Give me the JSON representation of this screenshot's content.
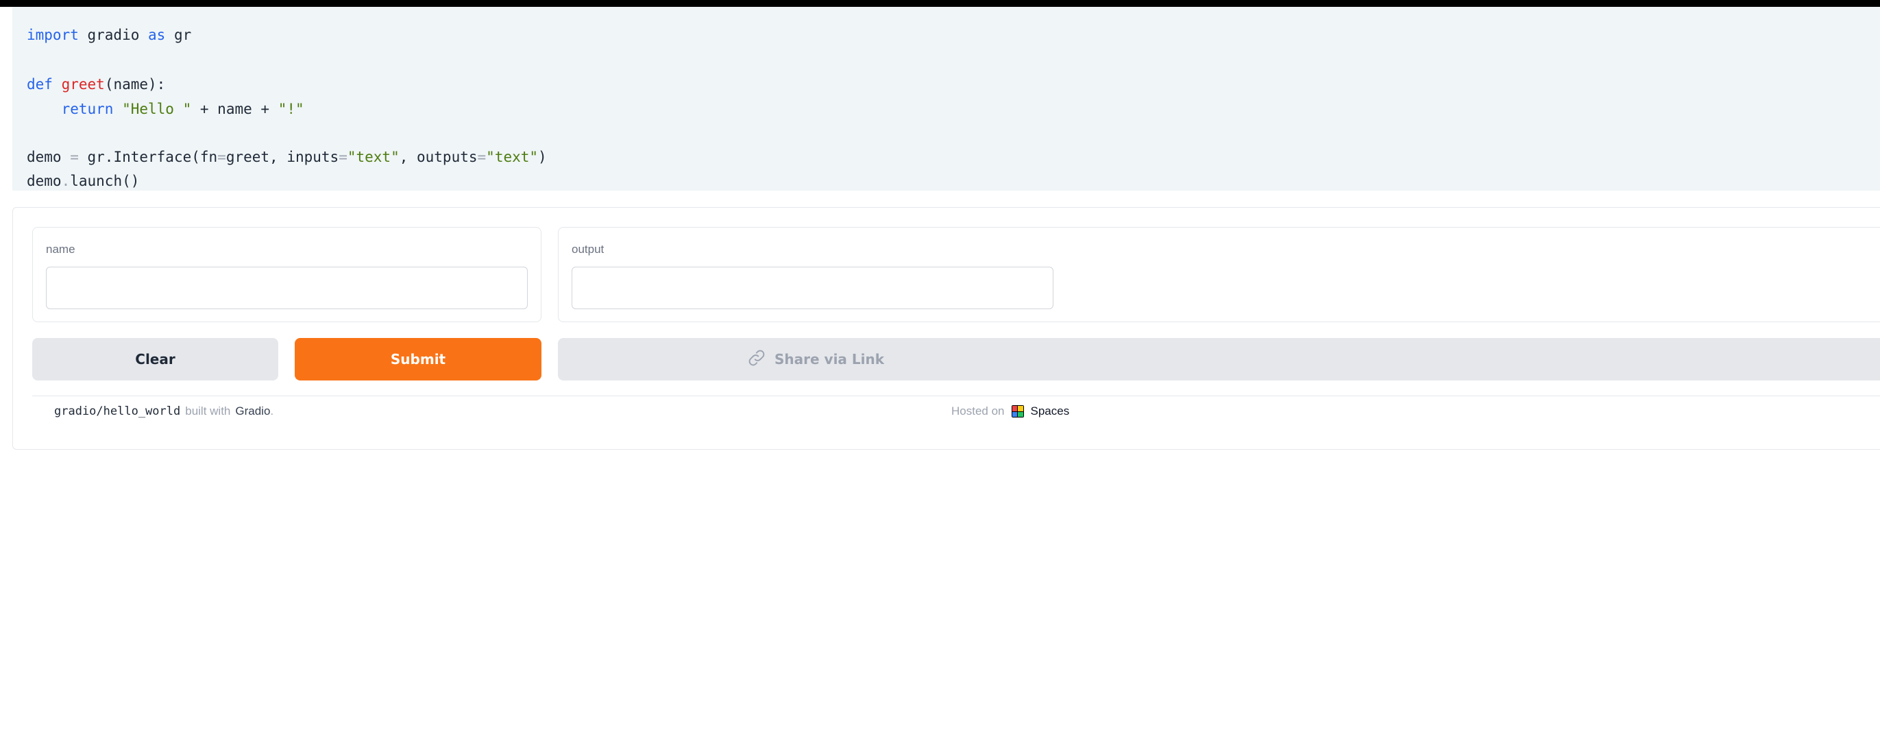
{
  "code": {
    "line1": {
      "k1": "import",
      "t1": " gradio ",
      "k2": "as",
      "t2": " gr"
    },
    "line2": {
      "k1": "def",
      "sp": " ",
      "fn": "greet",
      "rest": "(name):"
    },
    "line3": {
      "indent": "    ",
      "k1": "return",
      "sp": " ",
      "s1": "\"Hello \"",
      "mid": " + name + ",
      "s2": "\"!\""
    },
    "line4": {
      "a": "demo ",
      "eq": "=",
      "b": " gr.Interface(fn",
      "eq2": "=",
      "c": "greet, inputs",
      "eq3": "=",
      "s1": "\"text\"",
      "d": ", outputs",
      "eq4": "=",
      "s2": "\"text\"",
      "e": ")"
    },
    "line5": {
      "a": "demo",
      "dot": ".",
      "b": "launch()"
    }
  },
  "inputs": {
    "label": "name",
    "value": ""
  },
  "outputs": {
    "label": "output",
    "value": ""
  },
  "buttons": {
    "clear": "Clear",
    "submit": "Submit",
    "share": "Share via Link"
  },
  "footer": {
    "repo": "gradio/hello_world",
    "built_with": "built with",
    "brand": "Gradio",
    "period": ".",
    "hosted_on": "Hosted on",
    "spaces": "Spaces"
  },
  "colors": {
    "submit": "#f97316",
    "code_bg": "#f0f5f7"
  },
  "icons": {
    "share": "link-icon",
    "spaces": "spaces-logo-icon"
  }
}
